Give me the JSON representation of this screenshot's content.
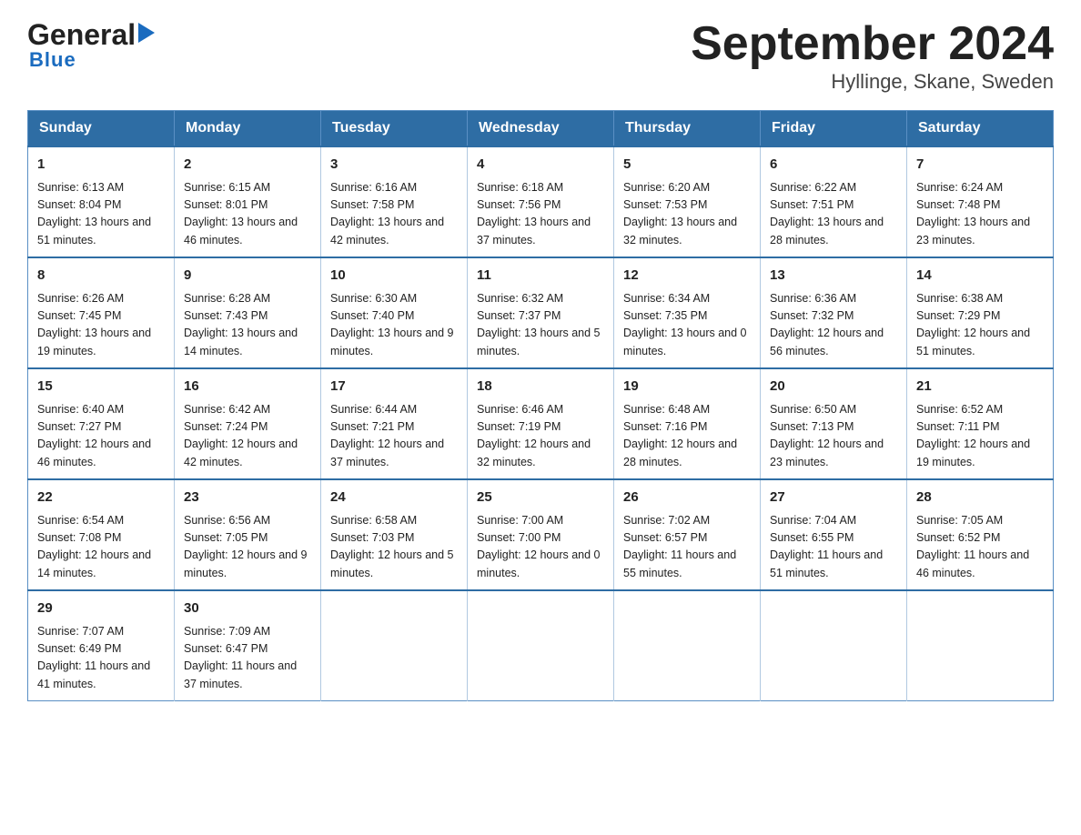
{
  "logo": {
    "text_general": "General",
    "triangle": "▶",
    "text_blue": "Blue"
  },
  "title": "September 2024",
  "subtitle": "Hyllinge, Skane, Sweden",
  "weekdays": [
    "Sunday",
    "Monday",
    "Tuesday",
    "Wednesday",
    "Thursday",
    "Friday",
    "Saturday"
  ],
  "weeks": [
    [
      {
        "day": "1",
        "sunrise": "6:13 AM",
        "sunset": "8:04 PM",
        "daylight": "13 hours and 51 minutes."
      },
      {
        "day": "2",
        "sunrise": "6:15 AM",
        "sunset": "8:01 PM",
        "daylight": "13 hours and 46 minutes."
      },
      {
        "day": "3",
        "sunrise": "6:16 AM",
        "sunset": "7:58 PM",
        "daylight": "13 hours and 42 minutes."
      },
      {
        "day": "4",
        "sunrise": "6:18 AM",
        "sunset": "7:56 PM",
        "daylight": "13 hours and 37 minutes."
      },
      {
        "day": "5",
        "sunrise": "6:20 AM",
        "sunset": "7:53 PM",
        "daylight": "13 hours and 32 minutes."
      },
      {
        "day": "6",
        "sunrise": "6:22 AM",
        "sunset": "7:51 PM",
        "daylight": "13 hours and 28 minutes."
      },
      {
        "day": "7",
        "sunrise": "6:24 AM",
        "sunset": "7:48 PM",
        "daylight": "13 hours and 23 minutes."
      }
    ],
    [
      {
        "day": "8",
        "sunrise": "6:26 AM",
        "sunset": "7:45 PM",
        "daylight": "13 hours and 19 minutes."
      },
      {
        "day": "9",
        "sunrise": "6:28 AM",
        "sunset": "7:43 PM",
        "daylight": "13 hours and 14 minutes."
      },
      {
        "day": "10",
        "sunrise": "6:30 AM",
        "sunset": "7:40 PM",
        "daylight": "13 hours and 9 minutes."
      },
      {
        "day": "11",
        "sunrise": "6:32 AM",
        "sunset": "7:37 PM",
        "daylight": "13 hours and 5 minutes."
      },
      {
        "day": "12",
        "sunrise": "6:34 AM",
        "sunset": "7:35 PM",
        "daylight": "13 hours and 0 minutes."
      },
      {
        "day": "13",
        "sunrise": "6:36 AM",
        "sunset": "7:32 PM",
        "daylight": "12 hours and 56 minutes."
      },
      {
        "day": "14",
        "sunrise": "6:38 AM",
        "sunset": "7:29 PM",
        "daylight": "12 hours and 51 minutes."
      }
    ],
    [
      {
        "day": "15",
        "sunrise": "6:40 AM",
        "sunset": "7:27 PM",
        "daylight": "12 hours and 46 minutes."
      },
      {
        "day": "16",
        "sunrise": "6:42 AM",
        "sunset": "7:24 PM",
        "daylight": "12 hours and 42 minutes."
      },
      {
        "day": "17",
        "sunrise": "6:44 AM",
        "sunset": "7:21 PM",
        "daylight": "12 hours and 37 minutes."
      },
      {
        "day": "18",
        "sunrise": "6:46 AM",
        "sunset": "7:19 PM",
        "daylight": "12 hours and 32 minutes."
      },
      {
        "day": "19",
        "sunrise": "6:48 AM",
        "sunset": "7:16 PM",
        "daylight": "12 hours and 28 minutes."
      },
      {
        "day": "20",
        "sunrise": "6:50 AM",
        "sunset": "7:13 PM",
        "daylight": "12 hours and 23 minutes."
      },
      {
        "day": "21",
        "sunrise": "6:52 AM",
        "sunset": "7:11 PM",
        "daylight": "12 hours and 19 minutes."
      }
    ],
    [
      {
        "day": "22",
        "sunrise": "6:54 AM",
        "sunset": "7:08 PM",
        "daylight": "12 hours and 14 minutes."
      },
      {
        "day": "23",
        "sunrise": "6:56 AM",
        "sunset": "7:05 PM",
        "daylight": "12 hours and 9 minutes."
      },
      {
        "day": "24",
        "sunrise": "6:58 AM",
        "sunset": "7:03 PM",
        "daylight": "12 hours and 5 minutes."
      },
      {
        "day": "25",
        "sunrise": "7:00 AM",
        "sunset": "7:00 PM",
        "daylight": "12 hours and 0 minutes."
      },
      {
        "day": "26",
        "sunrise": "7:02 AM",
        "sunset": "6:57 PM",
        "daylight": "11 hours and 55 minutes."
      },
      {
        "day": "27",
        "sunrise": "7:04 AM",
        "sunset": "6:55 PM",
        "daylight": "11 hours and 51 minutes."
      },
      {
        "day": "28",
        "sunrise": "7:05 AM",
        "sunset": "6:52 PM",
        "daylight": "11 hours and 46 minutes."
      }
    ],
    [
      {
        "day": "29",
        "sunrise": "7:07 AM",
        "sunset": "6:49 PM",
        "daylight": "11 hours and 41 minutes."
      },
      {
        "day": "30",
        "sunrise": "7:09 AM",
        "sunset": "6:47 PM",
        "daylight": "11 hours and 37 minutes."
      },
      null,
      null,
      null,
      null,
      null
    ]
  ],
  "labels": {
    "sunrise": "Sunrise:",
    "sunset": "Sunset:",
    "daylight": "Daylight:"
  }
}
